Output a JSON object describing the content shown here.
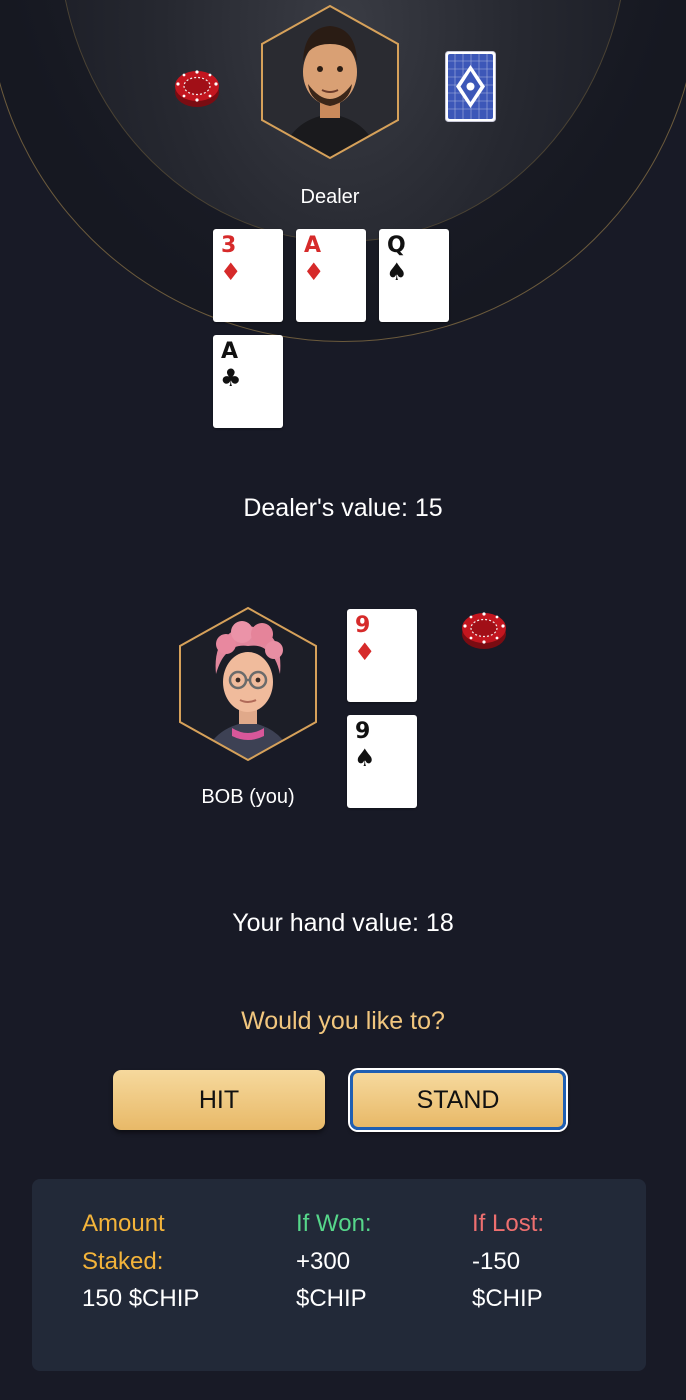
{
  "dealer": {
    "name": "Dealer",
    "cards": [
      {
        "rank": "3",
        "suit": "♦",
        "color": "red"
      },
      {
        "rank": "A",
        "suit": "♦",
        "color": "red"
      },
      {
        "rank": "Q",
        "suit": "♠",
        "color": "black"
      },
      {
        "rank": "A",
        "suit": "♣",
        "color": "black"
      }
    ],
    "value_text": "Dealer's value: 15"
  },
  "player": {
    "name": "BOB (you)",
    "cards": [
      {
        "rank": "9",
        "suit": "♦",
        "color": "red"
      },
      {
        "rank": "9",
        "suit": "♠",
        "color": "black"
      }
    ],
    "value_text": "Your hand value: 18"
  },
  "prompt": "Would you like to?",
  "actions": {
    "hit_label": "HIT",
    "stand_label": "STAND"
  },
  "stake": {
    "amount_header_line1": "Amount",
    "amount_header_line2": "Staked:",
    "amount_value": "150 $CHIP",
    "won_header": "If Won:",
    "won_value_line1": "+300",
    "won_value_line2": "$CHIP",
    "lost_header": "If Lost:",
    "lost_value_line1": "-150",
    "lost_value_line2": "$CHIP"
  },
  "colors": {
    "background": "#181a26",
    "gold_accent": "#f1c67e",
    "amount_color": "#f4b43a",
    "won_color": "#56d68a",
    "lost_color": "#ee6f6f",
    "panel": "#222938"
  },
  "icons": {
    "dealer_chip": "poker-chip-icon",
    "deck": "card-back-icon",
    "player_chip": "poker-chip-icon"
  }
}
